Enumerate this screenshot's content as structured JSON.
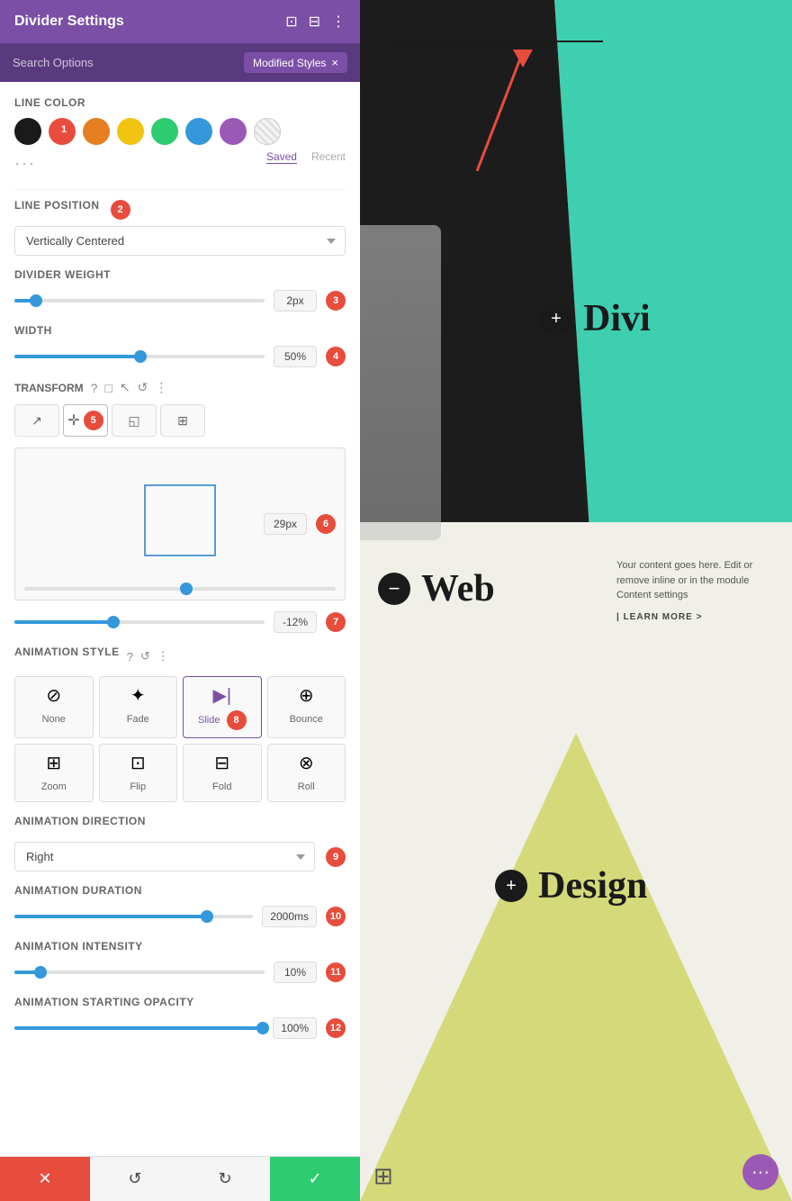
{
  "header": {
    "title": "Divider Settings"
  },
  "search": {
    "placeholder": "Search Options",
    "modified_label": "Modified Styles",
    "close": "×"
  },
  "line_color": {
    "label": "Line Color",
    "saved_label": "Saved",
    "recent_label": "Recent"
  },
  "line_position": {
    "label": "Line Position",
    "value": "Vertically Centered"
  },
  "divider_weight": {
    "label": "Divider Weight",
    "value": "2px",
    "step": "3"
  },
  "width": {
    "label": "Width",
    "value": "50%",
    "step": "4"
  },
  "transform": {
    "label": "Transform",
    "preview_value": "29px",
    "rotate_value": "-12%",
    "step": "6",
    "step_rotate": "7"
  },
  "animation_style": {
    "label": "Animation Style",
    "step": "8",
    "options": [
      {
        "id": "none",
        "label": "None",
        "icon": "⊘"
      },
      {
        "id": "fade",
        "label": "Fade",
        "icon": "✦"
      },
      {
        "id": "slide",
        "label": "Slide",
        "icon": "▶|"
      },
      {
        "id": "bounce",
        "label": "Bounce",
        "icon": "⊕"
      },
      {
        "id": "zoom",
        "label": "Zoom",
        "icon": "⊞"
      },
      {
        "id": "flip",
        "label": "Flip",
        "icon": "⊡"
      },
      {
        "id": "fold",
        "label": "Fold",
        "icon": "⊟"
      },
      {
        "id": "roll",
        "label": "Roll",
        "icon": "⊗"
      }
    ],
    "active": "slide"
  },
  "animation_direction": {
    "label": "Animation Direction",
    "value": "Right",
    "step": "9"
  },
  "animation_duration": {
    "label": "Animation Duration",
    "value": "2000ms",
    "step": "10"
  },
  "animation_intensity": {
    "label": "Animation Intensity",
    "value": "10%",
    "step": "11"
  },
  "animation_starting_opacity": {
    "label": "Animation Starting Opacity",
    "value": "100%",
    "step": "12"
  },
  "bottom_bar": {
    "cancel": "✕",
    "undo": "↺",
    "redo": "↻",
    "save": "✓"
  },
  "preview": {
    "divi_text": "Divi",
    "web_text": "Web",
    "design_text": "Design",
    "content_text": "Your content goes here. Edit or remove inline or in the module Content settings",
    "learn_more": "| LEARN MORE >"
  }
}
